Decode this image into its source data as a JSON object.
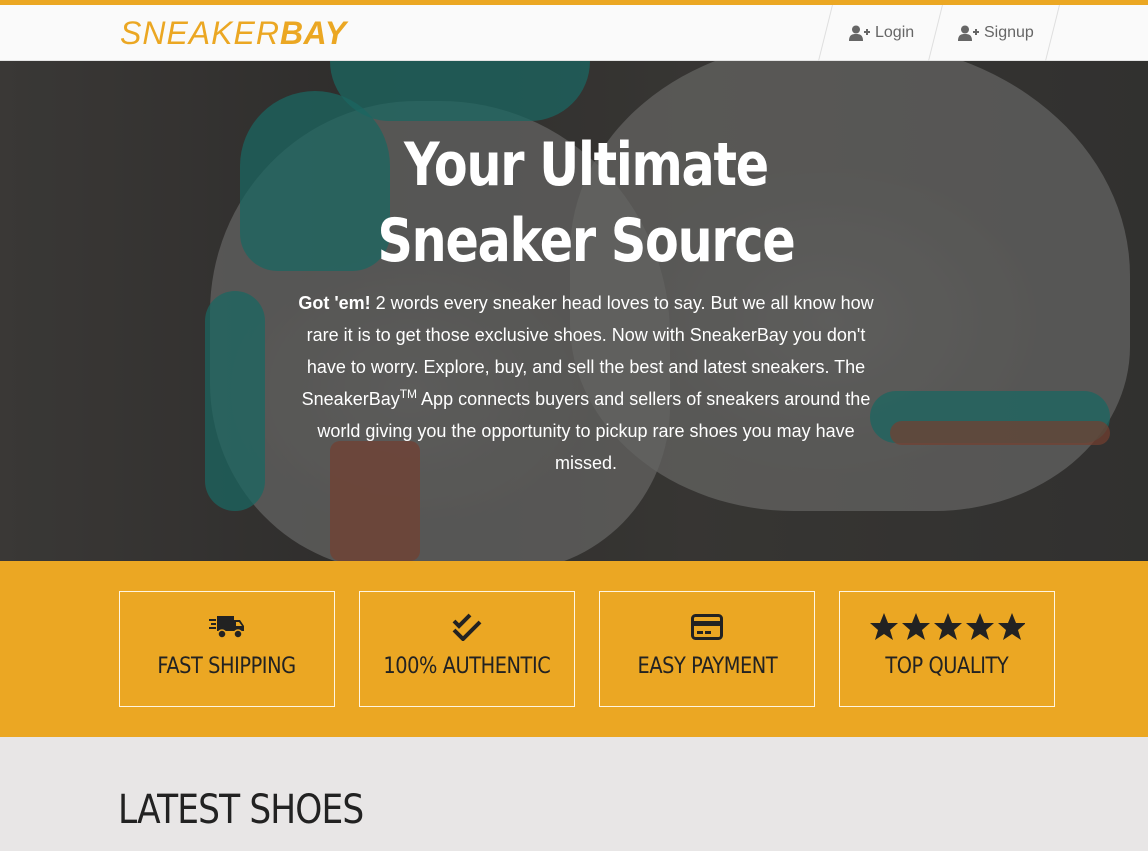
{
  "brand": {
    "logo_light": "SNEAKER",
    "logo_bold": "BAY",
    "accent": "#eba723"
  },
  "nav": {
    "login": {
      "label": "Login",
      "icon": "user-plus-icon"
    },
    "signup": {
      "label": "Signup",
      "icon": "user-plus-icon"
    }
  },
  "hero": {
    "title": "Your Ultimate Sneaker Source",
    "text_bold": "Got 'em!",
    "text_part1": " 2 words every sneaker head loves to say. But we all know how rare it is to get those exclusive shoes. Now with SneakerBay you don't have to worry. Explore, buy, and sell the best and latest sneakers. The SneakerBay",
    "text_sup": "TM",
    "text_part2": " App connects buyers and sellers of sneakers around the world giving you the opportunity to pickup rare shoes you may have missed."
  },
  "features": [
    {
      "label": "FAST SHIPPING",
      "icon": "shipping-truck-icon"
    },
    {
      "label": "100% AUTHENTIC",
      "icon": "double-check-icon"
    },
    {
      "label": "EASY PAYMENT",
      "icon": "credit-card-icon"
    },
    {
      "label": "TOP QUALITY",
      "icon": "five-stars-icon"
    }
  ],
  "latest": {
    "heading": "LATEST SHOES"
  }
}
